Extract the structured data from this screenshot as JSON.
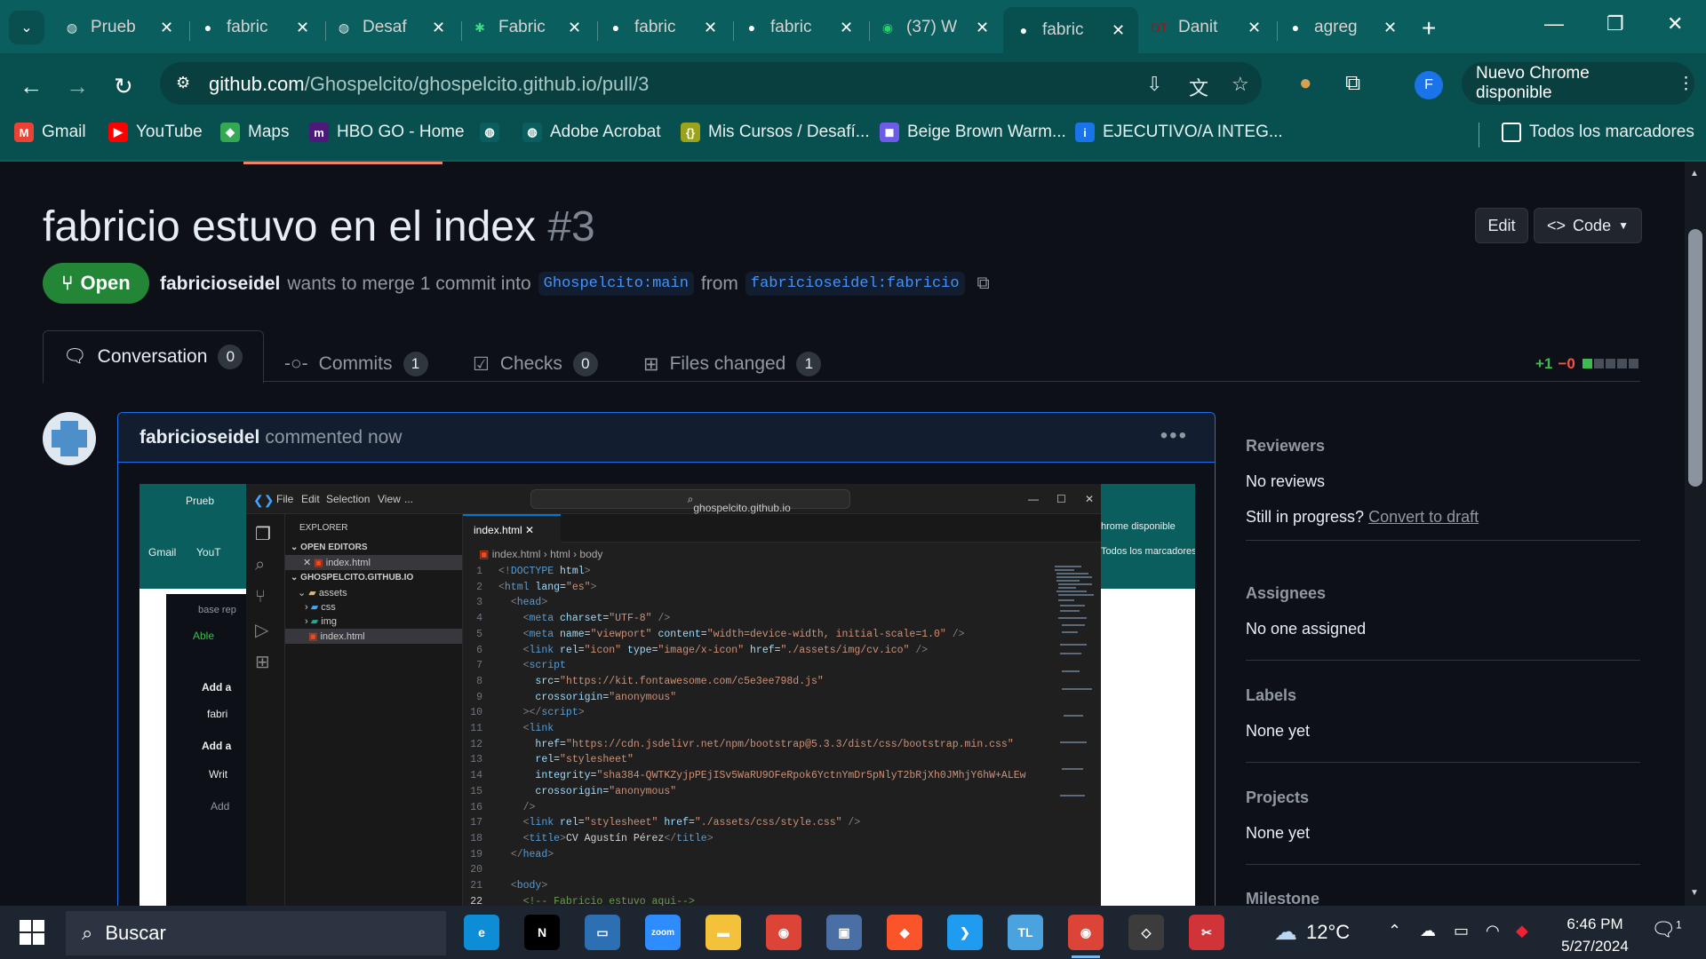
{
  "browser": {
    "tabs": [
      {
        "title": "Prueb",
        "icon": "globe-icon",
        "color": "#dfeaea"
      },
      {
        "title": "fabric",
        "icon": "github-icon",
        "color": "#ffffff"
      },
      {
        "title": "Desaf",
        "icon": "globe-icon",
        "color": "#dfeaea"
      },
      {
        "title": "Fabric",
        "icon": "asterisk-icon",
        "color": "#3ddc84"
      },
      {
        "title": "fabric",
        "icon": "github-icon",
        "color": "#ffffff"
      },
      {
        "title": "fabric",
        "icon": "github-icon",
        "color": "#ffffff"
      },
      {
        "title": "(37) W",
        "icon": "whatsapp-icon",
        "color": "#25d366"
      },
      {
        "title": "fabric",
        "icon": "github-icon",
        "color": "#ffffff",
        "active": true
      },
      {
        "title": "Danit",
        "icon": "dt-icon",
        "color": "#d00000"
      },
      {
        "title": "agreg",
        "icon": "github-icon",
        "color": "#ffffff"
      }
    ],
    "url_host": "github.com",
    "url_path": "/Ghospelcito/ghospelcito.github.io/pull/3",
    "update_label": "Nuevo Chrome disponible",
    "profile_initial": "F",
    "bookmarks": [
      {
        "label": "Gmail",
        "icon": "gmail-icon",
        "color": "#ea4335",
        "glyph": "M"
      },
      {
        "label": "YouTube",
        "icon": "youtube-icon",
        "color": "#ff0000",
        "glyph": "▶"
      },
      {
        "label": "Maps",
        "icon": "maps-icon",
        "color": "#34a853",
        "glyph": "◆"
      },
      {
        "label": "HBO GO - Home",
        "icon": "hbo-icon",
        "color": "#4b1a7a",
        "glyph": "m"
      },
      {
        "label": "",
        "icon": "globe-icon",
        "color": "#0b5e5e",
        "glyph": "◍"
      },
      {
        "label": "Adobe Acrobat",
        "icon": "globe-icon",
        "color": "#0b5e5e",
        "glyph": "◍"
      },
      {
        "label": "Mis Cursos / Desafí...",
        "icon": "cursos-icon",
        "color": "#9aa31a",
        "glyph": "{}"
      },
      {
        "label": "Beige Brown Warm...",
        "icon": "canva-icon",
        "color": "#6c5ce7",
        "glyph": "◼"
      },
      {
        "label": "EJECUTIVO/A INTEG...",
        "icon": "job-icon",
        "color": "#1a73e8",
        "glyph": "i"
      }
    ],
    "all_bookmarks": "Todos los marcadores"
  },
  "pr": {
    "title": "fabricio estuvo en el index",
    "number": "#3",
    "edit_label": "Edit",
    "code_label": "Code",
    "state": "Open",
    "author": "fabricioseidel",
    "merge_text": "wants to merge 1 commit into",
    "base_branch": "Ghospelcito:main",
    "from_text": "from",
    "head_branch": "fabricioseidel:fabricio",
    "tabs": [
      {
        "label": "Conversation",
        "count": "0"
      },
      {
        "label": "Commits",
        "count": "1"
      },
      {
        "label": "Checks",
        "count": "0"
      },
      {
        "label": "Files changed",
        "count": "1"
      }
    ],
    "additions": "+1",
    "deletions": "−0"
  },
  "comment": {
    "author": "fabricioseidel",
    "action": "commented now"
  },
  "screenshot": {
    "chrome_tab": "Prueb",
    "bookmarks": [
      "Gmail",
      "YouT"
    ],
    "left_texts": [
      "base rep",
      "Able",
      "Add a",
      "fabri",
      "Add a",
      "Writ",
      "Add"
    ],
    "right_texts": [
      "hrome disponible",
      "Todos los marcadores"
    ],
    "menu": [
      "File",
      "Edit",
      "Selection",
      "View",
      "..."
    ],
    "search": "ghospelcito.github.io",
    "explorer_title": "EXPLORER",
    "open_editors": "OPEN EDITORS",
    "open_file": "index.html",
    "folder": "GHOSPELCITO.GITHUB.IO",
    "tree": [
      "assets",
      "css",
      "img",
      "index.html"
    ],
    "tab": "index.html",
    "breadcrumb": [
      "index.html",
      "html",
      "body"
    ],
    "code": [
      [
        [
          "pu",
          "<!"
        ],
        [
          "tg",
          "DOCTYPE"
        ],
        [
          "at",
          " html"
        ],
        [
          "pu",
          ">"
        ]
      ],
      [
        [
          "pu",
          "<"
        ],
        [
          "tg",
          "html"
        ],
        [
          "at",
          " lang"
        ],
        [
          "tx",
          "="
        ],
        [
          "st",
          "\"es\""
        ],
        [
          "pu",
          ">"
        ]
      ],
      [
        [
          "tx",
          "  "
        ],
        [
          "pu",
          "<"
        ],
        [
          "tg",
          "head"
        ],
        [
          "pu",
          ">"
        ]
      ],
      [
        [
          "tx",
          "    "
        ],
        [
          "pu",
          "<"
        ],
        [
          "tg",
          "meta"
        ],
        [
          "at",
          " charset"
        ],
        [
          "tx",
          "="
        ],
        [
          "st",
          "\"UTF-8\""
        ],
        [
          "pu",
          " />"
        ]
      ],
      [
        [
          "tx",
          "    "
        ],
        [
          "pu",
          "<"
        ],
        [
          "tg",
          "meta"
        ],
        [
          "at",
          " name"
        ],
        [
          "tx",
          "="
        ],
        [
          "st",
          "\"viewport\""
        ],
        [
          "at",
          " content"
        ],
        [
          "tx",
          "="
        ],
        [
          "st",
          "\"width=device-width, initial-scale=1.0\""
        ],
        [
          "pu",
          " />"
        ]
      ],
      [
        [
          "tx",
          "    "
        ],
        [
          "pu",
          "<"
        ],
        [
          "tg",
          "link"
        ],
        [
          "at",
          " rel"
        ],
        [
          "tx",
          "="
        ],
        [
          "st",
          "\"icon\""
        ],
        [
          "at",
          " type"
        ],
        [
          "tx",
          "="
        ],
        [
          "st",
          "\"image/x-icon\""
        ],
        [
          "at",
          " href"
        ],
        [
          "tx",
          "="
        ],
        [
          "st",
          "\"./assets/img/cv.ico\""
        ],
        [
          "pu",
          " />"
        ]
      ],
      [
        [
          "tx",
          "    "
        ],
        [
          "pu",
          "<"
        ],
        [
          "tg",
          "script"
        ]
      ],
      [
        [
          "tx",
          "      "
        ],
        [
          "at",
          "src"
        ],
        [
          "tx",
          "="
        ],
        [
          "st",
          "\"https://kit.fontawesome.com/c5e3ee798d.js\""
        ]
      ],
      [
        [
          "tx",
          "      "
        ],
        [
          "at",
          "crossorigin"
        ],
        [
          "tx",
          "="
        ],
        [
          "st",
          "\"anonymous\""
        ]
      ],
      [
        [
          "tx",
          "    "
        ],
        [
          "pu",
          "></"
        ],
        [
          "tg",
          "script"
        ],
        [
          "pu",
          ">"
        ]
      ],
      [
        [
          "tx",
          "    "
        ],
        [
          "pu",
          "<"
        ],
        [
          "tg",
          "link"
        ]
      ],
      [
        [
          "tx",
          "      "
        ],
        [
          "at",
          "href"
        ],
        [
          "tx",
          "="
        ],
        [
          "st",
          "\"https://cdn.jsdelivr.net/npm/bootstrap@5.3.3/dist/css/bootstrap.min.css\""
        ]
      ],
      [
        [
          "tx",
          "      "
        ],
        [
          "at",
          "rel"
        ],
        [
          "tx",
          "="
        ],
        [
          "st",
          "\"stylesheet\""
        ]
      ],
      [
        [
          "tx",
          "      "
        ],
        [
          "at",
          "integrity"
        ],
        [
          "tx",
          "="
        ],
        [
          "st",
          "\"sha384-QWTKZyjpPEjISv5WaRU9OFeRpok6YctnYmDr5pNlyT2bRjXh0JMhjY6hW+ALEw"
        ]
      ],
      [
        [
          "tx",
          "      "
        ],
        [
          "at",
          "crossorigin"
        ],
        [
          "tx",
          "="
        ],
        [
          "st",
          "\"anonymous\""
        ]
      ],
      [
        [
          "tx",
          "    "
        ],
        [
          "pu",
          "/>"
        ]
      ],
      [
        [
          "tx",
          "    "
        ],
        [
          "pu",
          "<"
        ],
        [
          "tg",
          "link"
        ],
        [
          "at",
          " rel"
        ],
        [
          "tx",
          "="
        ],
        [
          "st",
          "\"stylesheet\""
        ],
        [
          "at",
          " href"
        ],
        [
          "tx",
          "="
        ],
        [
          "st",
          "\"./assets/css/style.css\""
        ],
        [
          "pu",
          " />"
        ]
      ],
      [
        [
          "tx",
          "    "
        ],
        [
          "pu",
          "<"
        ],
        [
          "tg",
          "title"
        ],
        [
          "pu",
          ">"
        ],
        [
          "tx",
          "CV Agustín Pérez"
        ],
        [
          "pu",
          "</"
        ],
        [
          "tg",
          "title"
        ],
        [
          "pu",
          ">"
        ]
      ],
      [
        [
          "tx",
          "  "
        ],
        [
          "pu",
          "</"
        ],
        [
          "tg",
          "head"
        ],
        [
          "pu",
          ">"
        ]
      ],
      [],
      [
        [
          "tx",
          "  "
        ],
        [
          "pu",
          "<"
        ],
        [
          "tg",
          "body"
        ],
        [
          "pu",
          ">"
        ]
      ],
      [
        [
          "tx",
          "    "
        ],
        [
          "cm",
          "<!-- Fabricio estuvo aqui-->"
        ]
      ]
    ]
  },
  "sidebar": [
    {
      "heading": "Reviewers",
      "value": "No reviews",
      "extra_prefix": "Still in progress?",
      "extra_link": "Convert to draft"
    },
    {
      "heading": "Assignees",
      "value": "No one assigned"
    },
    {
      "heading": "Labels",
      "value": "None yet"
    },
    {
      "heading": "Projects",
      "value": "None yet"
    },
    {
      "heading": "Milestone",
      "value": ""
    }
  ],
  "taskbar": {
    "search_placeholder": "Buscar",
    "apps": [
      {
        "name": "edge-icon",
        "color": "#0c8dd6",
        "glyph": "e"
      },
      {
        "name": "netflix-icon",
        "color": "#000000",
        "glyph": "N"
      },
      {
        "name": "desktop-icon",
        "color": "#2d6fb3",
        "glyph": "▭"
      },
      {
        "name": "zoom-icon",
        "color": "#2d8cff",
        "glyph": "zoom"
      },
      {
        "name": "explorer-icon",
        "color": "#f3c13a",
        "glyph": "▬"
      },
      {
        "name": "chrome-icon",
        "color": "#db4437",
        "glyph": "◉"
      },
      {
        "name": "remote-icon",
        "color": "#4a6fa5",
        "glyph": "▣"
      },
      {
        "name": "brave-icon",
        "color": "#fb542b",
        "glyph": "◆"
      },
      {
        "name": "vscode-icon",
        "color": "#1f9cf0",
        "glyph": "❯"
      },
      {
        "name": "tl-icon",
        "color": "#4aa3df",
        "glyph": "TL"
      },
      {
        "name": "chrome-profile-icon",
        "color": "#db4437",
        "glyph": "◉",
        "active": true
      },
      {
        "name": "git-icon",
        "color": "#3c3c3c",
        "glyph": "◇"
      },
      {
        "name": "snip-icon",
        "color": "#d13438",
        "glyph": "✂"
      }
    ],
    "temperature": "12°C",
    "time": "6:46 PM",
    "date": "5/27/2024",
    "notification_count": "1"
  }
}
